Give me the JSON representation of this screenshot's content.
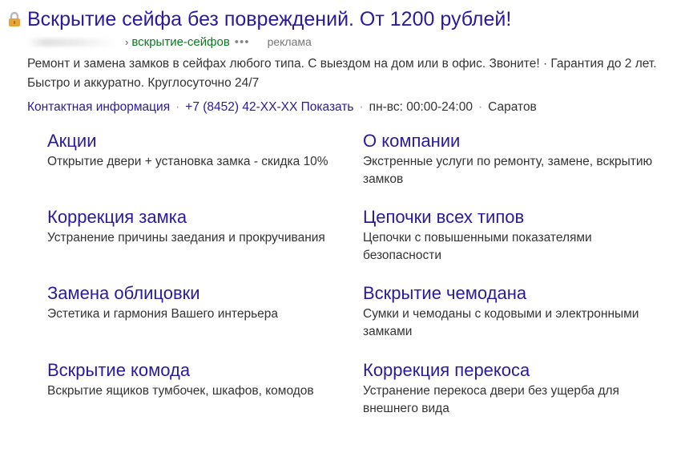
{
  "ad": {
    "title": "Вскрытие сейфа без повреждений. От 1200 рублей!",
    "icon": "lock-icon",
    "url_arrow": "›",
    "url_path": "вскрытие-сейфов",
    "url_more": "•••",
    "ad_label": "реклама",
    "description": "Ремонт и замена замков в сейфах любого типа. С выездом на дом или в офис. Звоните! · Гарантия до 2 лет. Быстро и аккуратно. Круглосуточно 24/7",
    "contacts": {
      "contact_info": "Контактная информация",
      "separator": "·",
      "phone": "+7 (8452) 42-XX-XX",
      "show": "Показать",
      "hours": "пн-вс: 00:00-24:00",
      "city": "Саратов"
    }
  },
  "sitelinks": [
    {
      "title": "Акции",
      "description": "Открытие двери + установка замка - скидка 10%"
    },
    {
      "title": "О компании",
      "description": "Экстренные услуги по ремонту, замене, вскрытию замков"
    },
    {
      "title": "Коррекция замка",
      "description": "Устранение причины заедания и прокручивания"
    },
    {
      "title": "Цепочки всех типов",
      "description": "Цепочки с повышенными показателями безопасности"
    },
    {
      "title": "Замена облицовки",
      "description": "Эстетика и гармония Вашего интерьера"
    },
    {
      "title": "Вскрытие чемодана",
      "description": "Сумки и чемоданы с кодовыми и электронными замками"
    },
    {
      "title": "Вскрытие комода",
      "description": "Вскрытие ящиков тумбочек, шкафов, комодов"
    },
    {
      "title": "Коррекция перекоса",
      "description": "Устранение перекоса двери без ущерба для внешнего вида"
    }
  ],
  "colors": {
    "link": "#2a1a9c",
    "url_green": "#0a7a1f",
    "text": "#333333",
    "lock_body": "#e8a23a",
    "lock_shackle": "#b8b8b8"
  }
}
